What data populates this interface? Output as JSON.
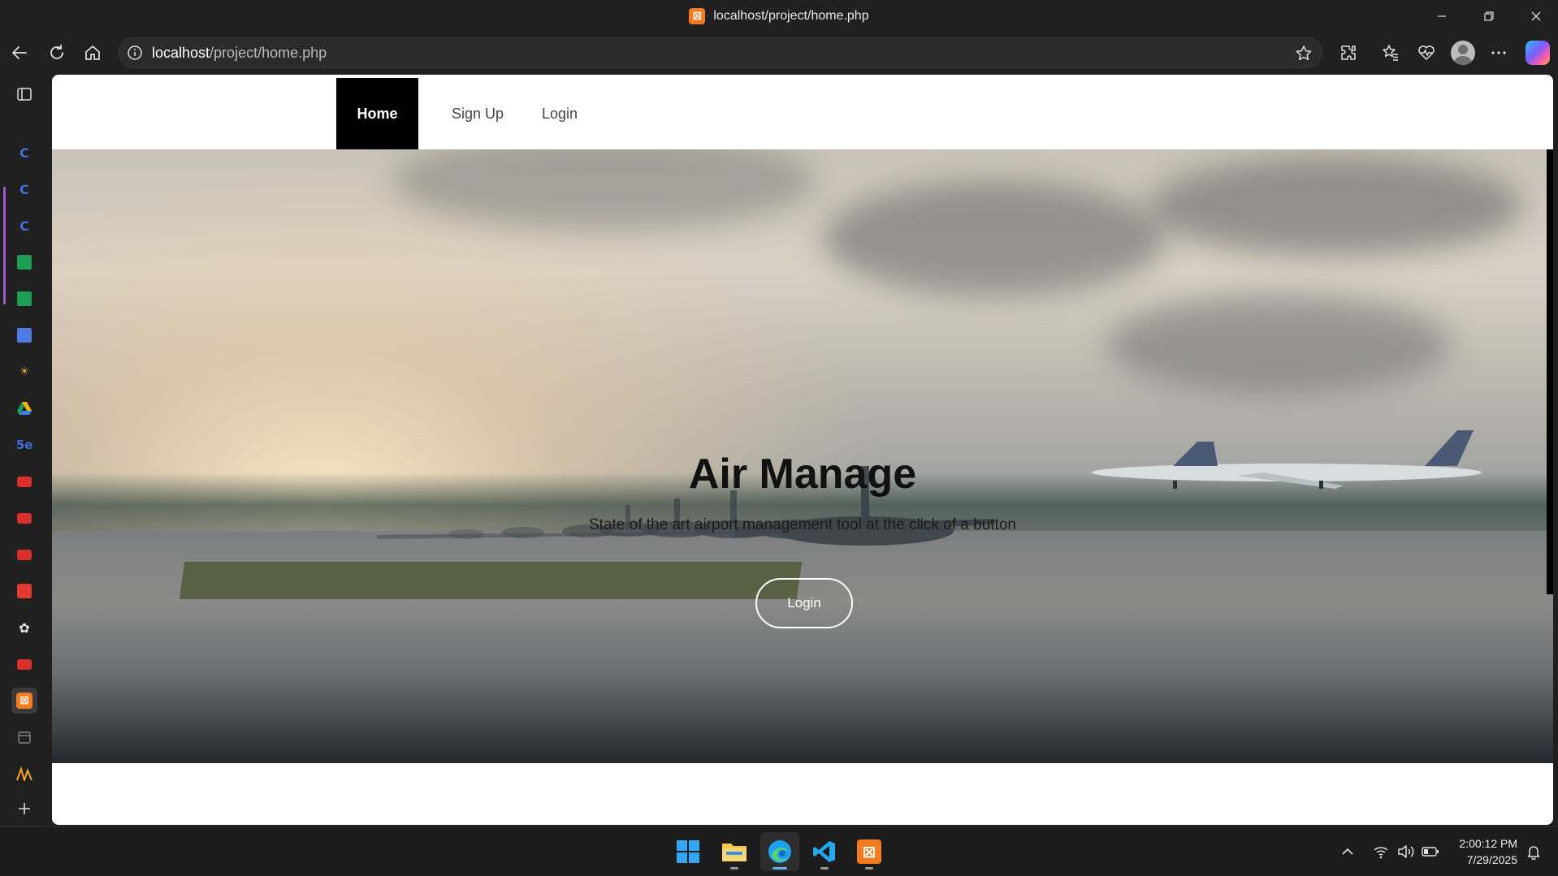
{
  "window": {
    "title": "localhost/project/home.php",
    "controls": [
      "minimize-icon",
      "restore-icon",
      "close-icon"
    ]
  },
  "toolbar": {
    "url_host": "localhost",
    "url_path": "/project/home.php",
    "buttons": [
      "back-icon",
      "refresh-icon",
      "home-icon",
      "info-icon",
      "favorite-star-icon",
      "extensions-icon",
      "favorites-icon",
      "browser-essentials-icon",
      "profile-avatar",
      "more-options-icon",
      "copilot-icon"
    ]
  },
  "sidebar": {
    "items": [
      "tab-actions-icon",
      "tab-c-1",
      "tab-c-2",
      "tab-c-3",
      "tab-green-1",
      "tab-green-2",
      "tab-docs",
      "tab-sun",
      "tab-drive",
      "tab-5e",
      "tab-youtube-1",
      "tab-youtube-2",
      "tab-youtube-3",
      "tab-pdf",
      "tab-chatgpt",
      "tab-youtube-4",
      "tab-xampp",
      "tab-calendar",
      "tab-wave",
      "new-tab-plus-icon"
    ]
  },
  "site": {
    "nav": [
      {
        "label": "Home",
        "active": true
      },
      {
        "label": "Sign Up",
        "active": false
      },
      {
        "label": "Login",
        "active": false
      }
    ],
    "hero": {
      "title": "Air Manage",
      "subtitle": "State of the art airport management tool at the click of a button",
      "button_label": "Login"
    }
  },
  "taskbar": {
    "apps": [
      "start-icon",
      "file-explorer-icon",
      "edge-icon",
      "vscode-icon",
      "xampp-icon"
    ],
    "time": "2:00:12 PM",
    "date": "7/29/2025",
    "tray": [
      "chevron-up-icon",
      "wifi-icon",
      "volume-icon",
      "battery-icon",
      "notifications-icon"
    ]
  },
  "colors": {
    "nav_active_bg": "#000000",
    "xampp_orange": "#f47c20",
    "edge_blue": "#1da1f2",
    "vscode_blue": "#23a9f2"
  }
}
